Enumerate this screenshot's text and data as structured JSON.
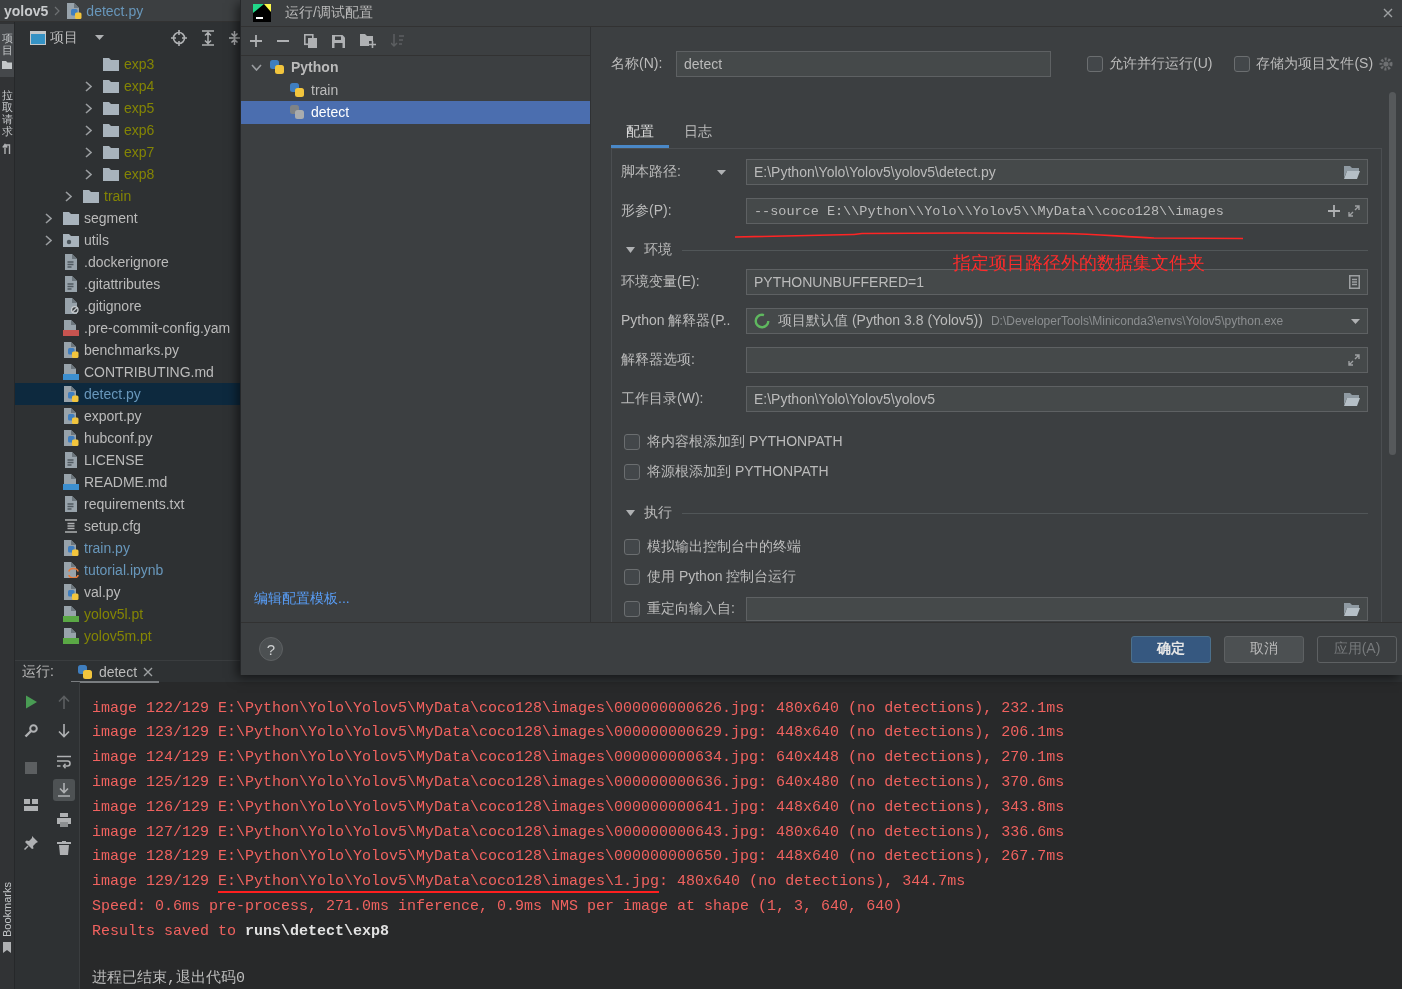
{
  "breadcrumb": {
    "items": [
      {
        "label": "yolov5",
        "kind": "project"
      },
      {
        "label": "detect.py",
        "kind": "python"
      }
    ]
  },
  "tool_strip": {
    "top": [
      {
        "label": "项目",
        "kind": "project",
        "selected": true
      },
      {
        "label": "拉取请求",
        "kind": "pulls",
        "selected": false
      }
    ],
    "bottom": [
      {
        "label": "Bookmarks",
        "kind": "bookmarks",
        "selected": false
      }
    ]
  },
  "project_panel": {
    "title": "项目",
    "tree": [
      {
        "children": [
          {
            "children": [
              {
                "label": "exp3",
                "kind": "folder",
                "color": "#848504",
                "selected": false
              },
              {
                "label": "exp4",
                "kind": "folder",
                "expanded": false,
                "color": "#848504",
                "selected": false
              },
              {
                "label": "exp5",
                "kind": "folder",
                "expanded": false,
                "color": "#848504",
                "selected": false
              },
              {
                "label": "exp6",
                "kind": "folder",
                "expanded": false,
                "color": "#848504",
                "selected": false
              },
              {
                "label": "exp7",
                "kind": "folder",
                "expanded": false,
                "color": "#848504",
                "selected": false
              },
              {
                "label": "exp8",
                "kind": "folder",
                "expanded": false,
                "color": "#848504",
                "selected": false
              }
            ]
          },
          {
            "label": "train",
            "kind": "folder",
            "expanded": false,
            "color": "#848504",
            "selected": false
          }
        ]
      },
      {
        "label": "segment",
        "kind": "folder",
        "expanded": false,
        "color": "#bbbbbb",
        "selected": false
      },
      {
        "label": "utils",
        "kind": "package",
        "expanded": false,
        "color": "#bbbbbb",
        "selected": false
      },
      {
        "label": ".dockerignore",
        "kind": "text",
        "color": "#bbbbbb",
        "selected": false
      },
      {
        "label": ".gitattributes",
        "kind": "text",
        "color": "#bbbbbb",
        "selected": false
      },
      {
        "label": ".gitignore",
        "kind": "ignore",
        "color": "#bbbbbb",
        "selected": false
      },
      {
        "label": ".pre-commit-config.yam",
        "kind": "yaml",
        "color": "#bbbbbb",
        "selected": false
      },
      {
        "label": "benchmarks.py",
        "kind": "python",
        "color": "#bbbbbb",
        "selected": false
      },
      {
        "label": "CONTRIBUTING.md",
        "kind": "markdown",
        "color": "#bbbbbb",
        "selected": false
      },
      {
        "label": "detect.py",
        "kind": "python",
        "color": "#6897bb",
        "selected": true
      },
      {
        "label": "export.py",
        "kind": "python",
        "color": "#bbbbbb",
        "selected": false
      },
      {
        "label": "hubconf.py",
        "kind": "python",
        "color": "#bbbbbb",
        "selected": false
      },
      {
        "label": "LICENSE",
        "kind": "text",
        "color": "#bbbbbb",
        "selected": false
      },
      {
        "label": "README.md",
        "kind": "markdown",
        "color": "#bbbbbb",
        "selected": false
      },
      {
        "label": "requirements.txt",
        "kind": "text",
        "color": "#bbbbbb",
        "selected": false
      },
      {
        "label": "setup.cfg",
        "kind": "config",
        "color": "#bbbbbb",
        "selected": false
      },
      {
        "label": "train.py",
        "kind": "python",
        "color": "#6897bb",
        "selected": false
      },
      {
        "label": "tutorial.ipynb",
        "kind": "notebook",
        "color": "#6897bb",
        "selected": false
      },
      {
        "label": "val.py",
        "kind": "python",
        "color": "#bbbbbb",
        "selected": false
      },
      {
        "label": "yolov5l.pt",
        "kind": "model",
        "color": "#848504",
        "selected": false
      },
      {
        "label": "yolov5m.pt",
        "kind": "model",
        "color": "#848504",
        "selected": false
      }
    ]
  },
  "run_panel": {
    "title": "运行:",
    "tabs": [
      {
        "label": "detect",
        "selected": true
      }
    ],
    "toolbar": [
      {
        "buttons": [
          {
            "kind": "run",
            "disabled": false,
            "on": false
          },
          {
            "kind": "settings",
            "disabled": false,
            "on": false
          },
          {
            "kind": "stop",
            "disabled": true,
            "on": false
          },
          {
            "kind": "layout",
            "disabled": false,
            "on": false
          },
          {
            "kind": "pin",
            "disabled": false,
            "on": false
          }
        ]
      },
      {
        "buttons": [
          {
            "kind": "up",
            "disabled": true,
            "on": false
          },
          {
            "kind": "down",
            "disabled": false,
            "on": false
          },
          {
            "kind": "wrap",
            "disabled": false,
            "on": false
          },
          {
            "kind": "scroll",
            "disabled": false,
            "on": true
          },
          {
            "kind": "print",
            "disabled": false,
            "on": false
          },
          {
            "kind": "trash",
            "disabled": false,
            "on": false
          }
        ]
      }
    ],
    "console": {
      "lines": [
        {
          "kind": "stderr",
          "text": "image 122/129 E:\\Python\\Yolo\\Yolov5\\MyData\\coco128\\images\\000000000626.jpg: 480x640 (no detections), 232.1ms"
        },
        {
          "kind": "stderr",
          "text": "image 123/129 E:\\Python\\Yolo\\Yolov5\\MyData\\coco128\\images\\000000000629.jpg: 448x640 (no detections), 206.1ms"
        },
        {
          "kind": "stderr",
          "text": "image 124/129 E:\\Python\\Yolo\\Yolov5\\MyData\\coco128\\images\\000000000634.jpg: 640x448 (no detections), 270.1ms"
        },
        {
          "kind": "stderr",
          "text": "image 125/129 E:\\Python\\Yolo\\Yolov5\\MyData\\coco128\\images\\000000000636.jpg: 640x480 (no detections), 370.6ms"
        },
        {
          "kind": "stderr",
          "text": "image 126/129 E:\\Python\\Yolo\\Yolov5\\MyData\\coco128\\images\\000000000641.jpg: 448x640 (no detections), 343.8ms"
        },
        {
          "kind": "stderr",
          "text": "image 127/129 E:\\Python\\Yolo\\Yolov5\\MyData\\coco128\\images\\000000000643.jpg: 480x640 (no detections), 336.6ms"
        },
        {
          "kind": "stderr",
          "text": "image 128/129 E:\\Python\\Yolo\\Yolov5\\MyData\\coco128\\images\\000000000650.jpg: 448x640 (no detections), 267.7ms"
        },
        {
          "kind": "stderr",
          "parts": [
            {
              "text": "image 129/129 ",
              "underlined": false
            },
            {
              "text": "E:\\Python\\Yolo\\Yolov5\\MyData\\coco128\\images\\1.jpg",
              "underlined": true
            },
            {
              "text": ": 480x640 (no detections), 344.7ms",
              "underlined": false
            }
          ]
        },
        {
          "kind": "stderr",
          "text": "Speed: 0.6ms pre-process, 271.0ms inference, 0.9ms NMS per image at shape (1, 3, 640, 640)"
        },
        {
          "kind": "stderr",
          "text": "Results saved to **runs\\detect\\exp8**"
        },
        {
          "kind": "system",
          "text": "进程已结束,退出代码0"
        }
      ]
    }
  },
  "dialog": {
    "title": "运行/调试配置",
    "toolbar": [
      {
        "kind": "add",
        "disabled": false
      },
      {
        "kind": "remove",
        "disabled": false
      },
      {
        "kind": "copy",
        "disabled": false
      },
      {
        "kind": "save",
        "disabled": false
      },
      {
        "kind": "folder",
        "disabled": false
      },
      {
        "kind": "sort",
        "disabled": true
      }
    ],
    "tree": [
      {
        "label": "Python",
        "kind": "group",
        "expanded": true,
        "selected": false,
        "children": [
          {
            "label": "train",
            "kind": "config",
            "temporary": false,
            "selected": false
          },
          {
            "label": "detect",
            "kind": "config",
            "temporary": true,
            "selected": true
          }
        ]
      }
    ],
    "template_link": "编辑配置模板...",
    "name": {
      "label": "名称(N):",
      "value": "detect"
    },
    "options": [
      {
        "label": "允许并行运行(U)",
        "checked": false
      },
      {
        "label": "存储为项目文件(S)",
        "checked": false
      }
    ],
    "tabs": [
      {
        "label": "配置",
        "selected": true
      },
      {
        "label": "日志",
        "selected": false
      }
    ],
    "form": [
      {
        "kind": "path",
        "label": "脚本路径:",
        "menu": true,
        "value": "E:\\Python\\Yolo\\Yolov5\\yolov5\\detect.py"
      },
      {
        "kind": "args",
        "label": "形参(P):",
        "value": "--source E:\\\\Python\\\\Yolo\\\\Yolov5\\\\MyData\\\\coco128\\\\images",
        "annotation": "指定项目路径外的数据集文件夹"
      },
      {
        "kind": "section",
        "label": "环境",
        "expanded": true
      },
      {
        "kind": "env",
        "label": "环境变量(E):",
        "value": "PYTHONUNBUFFERED=1"
      },
      {
        "kind": "select",
        "label": "Python 解释器(P..",
        "value": "项目默认值 (Python 3.8 (Yolov5))",
        "detail": "D:\\DeveloperTools\\Miniconda3\\envs\\Yolov5\\python.exe"
      },
      {
        "kind": "options",
        "label": "解释器选项:"
      },
      {
        "kind": "path",
        "label": "工作目录(W):",
        "value": "E:\\Python\\Yolo\\Yolov5\\yolov5"
      },
      {
        "kind": "checkbox",
        "label": "将内容根添加到 PYTHONPATH",
        "checked": false
      },
      {
        "kind": "checkbox",
        "label": "将源根添加到 PYTHONPATH",
        "checked": false
      },
      {
        "kind": "section",
        "label": "执行",
        "expanded": true
      },
      {
        "kind": "checkbox",
        "label": "模拟输出控制台中的终端",
        "checked": false
      },
      {
        "kind": "checkbox",
        "label": "使用 Python 控制台运行",
        "checked": false
      },
      {
        "kind": "redirect",
        "label": "重定向输入自:",
        "checked": false
      }
    ],
    "help": "?",
    "buttons": [
      {
        "label": "确定",
        "kind": "primary",
        "disabled": false
      },
      {
        "label": "取消",
        "kind": "default",
        "disabled": false
      },
      {
        "label": "应用(A)",
        "kind": "default",
        "disabled": true
      }
    ]
  }
}
